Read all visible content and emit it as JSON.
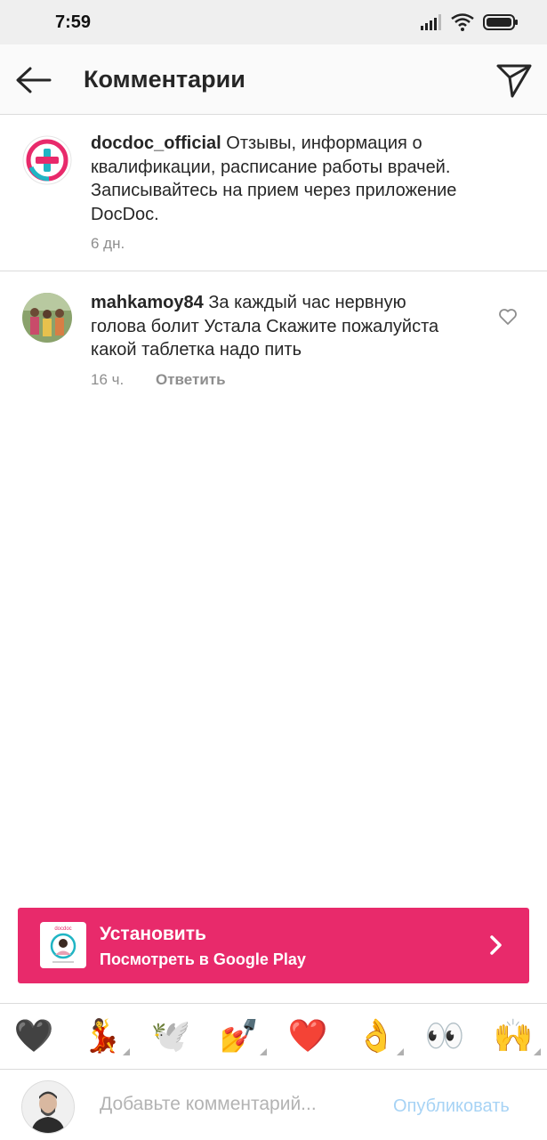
{
  "status_bar": {
    "time": "7:59"
  },
  "header": {
    "title": "Комментарии",
    "back_icon": "arrow-left-icon",
    "share_icon": "paper-plane-icon"
  },
  "post": {
    "username": "docdoc_official",
    "text": "Отзывы, информация о квалификации, расписание работы врачей. Записывайтесь на прием через приложение DocDoc.",
    "time": "6 дн."
  },
  "comments": [
    {
      "username": "mahkamoy84",
      "text": "За каждый час нервную голова болит Устала Скажите пожалуйста какой таблетка надо пить",
      "time": "16 ч.",
      "reply_label": "Ответить"
    }
  ],
  "banner": {
    "title": "Установить",
    "subtitle": "Посмотреть в Google Play",
    "icon_text": "docdoc",
    "color": "#e82a6b"
  },
  "emoji_bar": [
    "🖤",
    "💃",
    "🕊️",
    "💅",
    "❤️",
    "👌",
    "👀",
    "🙌"
  ],
  "composer": {
    "placeholder": "Добавьте комментарий...",
    "publish_label": "Опубликовать"
  },
  "colors": {
    "accent_blue": "#a7d3f5",
    "meta_gray": "#8e8e8e",
    "brand_pink": "#e82a6b"
  }
}
